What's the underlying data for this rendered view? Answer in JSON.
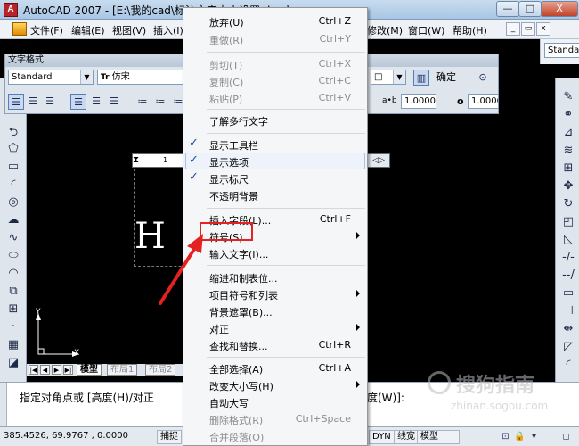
{
  "window": {
    "title": "AutoCAD 2007 - [E:\\我的cad\\标注文字大小设置.dwg]",
    "controls": [
      "—",
      "□",
      "X"
    ]
  },
  "menubar": {
    "items": [
      "文件(F)",
      "编辑(E)",
      "视图(V)",
      "插入(I)",
      "修改(M)",
      "窗口(W)",
      "帮助(H)"
    ],
    "mdi": [
      "_",
      "▭",
      "x"
    ]
  },
  "right_top": {
    "style_combo": "Standa",
    "layer_label": "Layer"
  },
  "format_toolbar": {
    "caption": "文字格式",
    "style": "Standard",
    "font": "仿宋",
    "font_prefix": "Tr",
    "color_combo": "□",
    "ok": "确定",
    "tracking_prefix": "a•b",
    "tracking": "1.0000",
    "width_factor_prefix": "o",
    "width_factor": "1.0000"
  },
  "editor": {
    "glyph": "H",
    "ruler_tick": "1",
    "ruler_ctrl": "◁▷"
  },
  "ucs": {
    "x_label": "X",
    "y_label": "Y"
  },
  "layout_tabs": {
    "items": [
      "模型",
      "布局1",
      "布局2"
    ],
    "active": "模型"
  },
  "command": {
    "line1_prefix": "指定对角点或 [高度(H)/对正",
    "line1_suffix": "度(W)]:"
  },
  "status": {
    "coords": "385.4526, 69.9767 , 0.0000",
    "snap": "捕捉",
    "dyn": "DYN",
    "lweight": "线宽",
    "model": "模型"
  },
  "context_menu": {
    "items": [
      {
        "label": "放弃(U)",
        "shortcut": "Ctrl+Z",
        "enabled": true
      },
      {
        "label": "重做(R)",
        "shortcut": "Ctrl+Y",
        "enabled": false
      },
      {
        "label": "剪切(T)",
        "shortcut": "Ctrl+X",
        "enabled": false
      },
      {
        "label": "复制(C)",
        "shortcut": "Ctrl+C",
        "enabled": false
      },
      {
        "label": "粘贴(P)",
        "shortcut": "Ctrl+V",
        "enabled": false
      },
      {
        "label": "了解多行文字",
        "shortcut": "",
        "enabled": true
      },
      {
        "label": "显示工具栏",
        "shortcut": "",
        "enabled": true,
        "checked": true
      },
      {
        "label": "显示选项",
        "shortcut": "",
        "enabled": true,
        "checked": true,
        "highlighted": true
      },
      {
        "label": "显示标尺",
        "shortcut": "",
        "enabled": true,
        "checked": true
      },
      {
        "label": "不透明背景",
        "shortcut": "",
        "enabled": true
      },
      {
        "label": "插入字段(L)...",
        "shortcut": "Ctrl+F",
        "enabled": true
      },
      {
        "label": "符号(S)",
        "shortcut": "",
        "enabled": true,
        "submenu": true,
        "annotated": true
      },
      {
        "label": "输入文字(I)...",
        "shortcut": "",
        "enabled": true
      },
      {
        "label": "缩进和制表位...",
        "shortcut": "",
        "enabled": true
      },
      {
        "label": "项目符号和列表",
        "shortcut": "",
        "enabled": true,
        "submenu": true
      },
      {
        "label": "背景遮罩(B)...",
        "shortcut": "",
        "enabled": true
      },
      {
        "label": "对正",
        "shortcut": "",
        "enabled": true,
        "submenu": true
      },
      {
        "label": "查找和替换...",
        "shortcut": "Ctrl+R",
        "enabled": true
      },
      {
        "label": "全部选择(A)",
        "shortcut": "Ctrl+A",
        "enabled": true
      },
      {
        "label": "改变大小写(H)",
        "shortcut": "",
        "enabled": true,
        "submenu": true
      },
      {
        "label": "自动大写",
        "shortcut": "",
        "enabled": true
      },
      {
        "label": "删除格式(R)",
        "shortcut": "Ctrl+Space",
        "enabled": false
      },
      {
        "label": "合并段落(O)",
        "shortcut": "",
        "enabled": false
      }
    ]
  },
  "watermark": {
    "brand": "搜狗指南",
    "url": "zhinan.sogou.com"
  },
  "colors": {
    "annotation": "#e52222",
    "check": "#1f4e9e",
    "canvas": "#000000"
  }
}
